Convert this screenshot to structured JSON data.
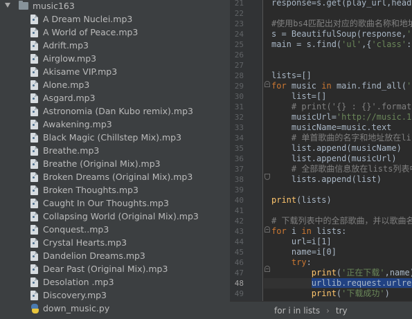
{
  "project_tree": {
    "folder": {
      "label": "music163",
      "icon": "folder-icon"
    },
    "files": [
      {
        "name": "A Dream Nuclei.mp3",
        "icon": "audio-file-icon"
      },
      {
        "name": "A World of Peace.mp3",
        "icon": "audio-file-icon"
      },
      {
        "name": "Adrift.mp3",
        "icon": "audio-file-icon"
      },
      {
        "name": "Airglow.mp3",
        "icon": "audio-file-icon"
      },
      {
        "name": "Akisame VIP.mp3",
        "icon": "audio-file-icon"
      },
      {
        "name": "Alone.mp3",
        "icon": "audio-file-icon"
      },
      {
        "name": "Asgard.mp3",
        "icon": "audio-file-icon"
      },
      {
        "name": "Astronomia (Dan Kubo remix).mp3",
        "icon": "audio-file-icon"
      },
      {
        "name": "Awakening.mp3",
        "icon": "audio-file-icon"
      },
      {
        "name": "Black Magic (Chillstep Mix).mp3",
        "icon": "audio-file-icon"
      },
      {
        "name": "Breathe.mp3",
        "icon": "audio-file-icon"
      },
      {
        "name": "Breathe (Original Mix).mp3",
        "icon": "audio-file-icon"
      },
      {
        "name": "Broken Dreams (Original Mix).mp3",
        "icon": "audio-file-icon"
      },
      {
        "name": "Broken Thoughts.mp3",
        "icon": "audio-file-icon"
      },
      {
        "name": "Caught In Our Thoughts.mp3",
        "icon": "audio-file-icon"
      },
      {
        "name": "Collapsing World (Original Mix).mp3",
        "icon": "audio-file-icon"
      },
      {
        "name": "Conquest..mp3",
        "icon": "audio-file-icon"
      },
      {
        "name": "Crystal Hearts.mp3",
        "icon": "audio-file-icon"
      },
      {
        "name": "Dandelion Dreams.mp3",
        "icon": "audio-file-icon"
      },
      {
        "name": "Dear Past (Original Mix).mp3",
        "icon": "audio-file-icon"
      },
      {
        "name": "Desolation .mp3",
        "icon": "audio-file-icon"
      },
      {
        "name": "Discovery.mp3",
        "icon": "audio-file-icon"
      },
      {
        "name": "down_music.py",
        "icon": "python-file-icon"
      }
    ]
  },
  "editor": {
    "current_line": "48",
    "line_numbers": [
      "21",
      "22",
      "23",
      "24",
      "25",
      "26",
      "27",
      "28",
      "29",
      "30",
      "31",
      "32",
      "33",
      "34",
      "35",
      "36",
      "37",
      "38",
      "39",
      "40",
      "41",
      "42",
      "43",
      "44",
      "45",
      "46",
      "47",
      "48",
      "49"
    ],
    "lines": [
      "response=s.get(play_url,heade",
      "",
      "#使用bs4匹配出对应的歌曲名称和地址",
      "s = BeautifulSoup(response,'l",
      "main = s.find('ul',{'class':'",
      "",
      "",
      "lists=[]",
      "for music in main.find_all('a",
      "    list=[]",
      "    # print('{} : {}'.format(",
      "    musicUrl='http://music.16",
      "    musicName=music.text",
      "    # 单首歌曲的名字和地址放在lis",
      "    list.append(musicName)",
      "    list.append(musicUrl)",
      "    # 全部歌曲信息放在lists列表中",
      "    lists.append(list)",
      "",
      "print(lists)",
      "",
      "# 下载列表中的全部歌曲，并以歌曲名",
      "for i in lists:",
      "    url=i[1]",
      "    name=i[0]",
      "    try:",
      "        print('正在下载',name)",
      "        urllib.request.urlret",
      "        print('下载成功')"
    ]
  },
  "breadcrumb": {
    "items": [
      "for i in lists",
      "try"
    ],
    "separator": "›"
  },
  "colors": {
    "keyword": "#cc7832",
    "string": "#6a8759",
    "comment": "#808080",
    "builtin": "#ffc66d",
    "default": "#a9b7c6",
    "selection": "#214283"
  }
}
